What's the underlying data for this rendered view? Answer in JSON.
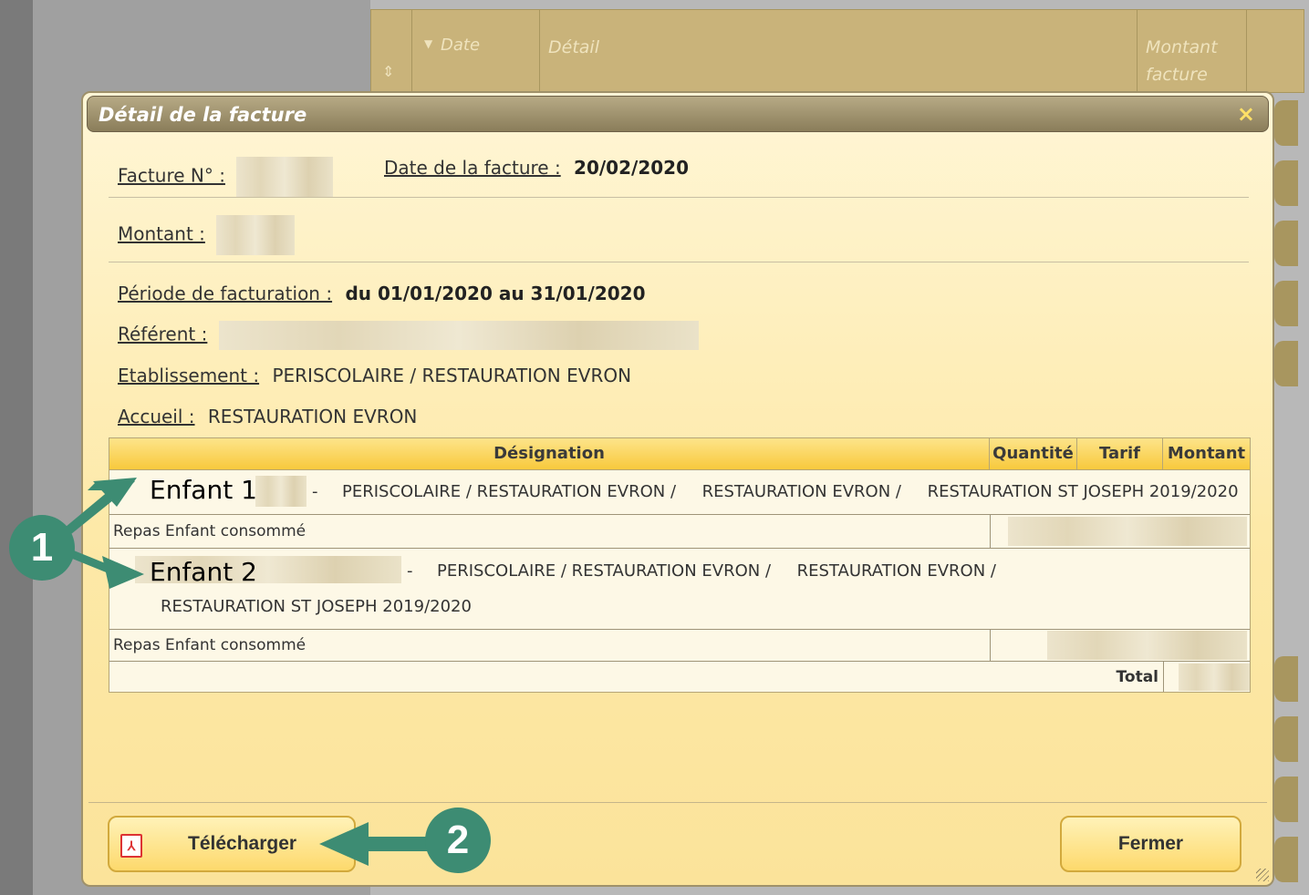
{
  "background_table": {
    "col_date": "Date",
    "col_detail": "Détail",
    "col_montant_l1": "Montant",
    "col_montant_l2": "facture"
  },
  "dialog": {
    "title": "Détail de la facture",
    "close_glyph": "×",
    "facture_label": "Facture N° :",
    "date_label": "Date de la facture :",
    "date_value": "20/02/2020",
    "montant_label": "Montant :",
    "periode_label": "Période de facturation :",
    "periode_value": "du 01/01/2020 au 31/01/2020",
    "referent_label": "Référent :",
    "etablissement_label": "Etablissement :",
    "etablissement_value": "PERISCOLAIRE / RESTAURATION EVRON",
    "accueil_label": "Accueil :",
    "accueil_value": "RESTAURATION EVRON"
  },
  "table": {
    "headers": [
      "Désignation",
      "Quantité",
      "Tarif",
      "Montant"
    ],
    "group1": {
      "dash": "-",
      "path": "PERISCOLAIRE / RESTAURATION EVRON /     RESTAURATION EVRON /     RESTAURATION ST JOSEPH 2019/2020",
      "line_label": "Repas Enfant consommé"
    },
    "group2": {
      "dash": "-",
      "path_l1": "PERISCOLAIRE / RESTAURATION EVRON /     RESTAURATION EVRON /",
      "path_l2": "RESTAURATION ST JOSEPH 2019/2020",
      "line_label": "Repas Enfant consommé"
    },
    "total_label": "Total"
  },
  "annotations": {
    "enfant1": "Enfant 1",
    "enfant2": "Enfant 2",
    "badge1": "1",
    "badge2": "2"
  },
  "buttons": {
    "download": "Télécharger",
    "close": "Fermer"
  },
  "colors": {
    "accent_green": "#3d8c73",
    "header_yellow": "#f8c93c"
  }
}
